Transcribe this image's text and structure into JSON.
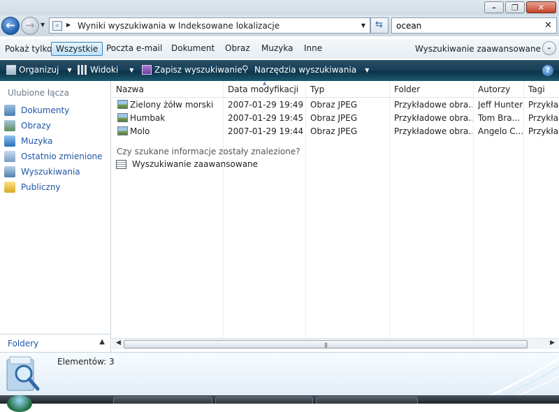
{
  "window": {
    "buttons": {
      "minimize": "minimize-icon",
      "maximize": "restore-icon",
      "close": "close-icon"
    }
  },
  "address": {
    "path": "Wyniki wyszukiwania w Indeksowane lokalizacje"
  },
  "search": {
    "value": "ocean"
  },
  "filter": {
    "label": "Pokaż tylko:",
    "options": [
      "Wszystkie",
      "Poczta e-mail",
      "Dokument",
      "Obraz",
      "Muzyka",
      "Inne"
    ],
    "active": "Wszystkie",
    "advanced": "Wyszukiwanie zaawansowane"
  },
  "toolbar": {
    "organize": "Organizuj",
    "views": "Widoki",
    "save_search": "Zapisz wyszukiwanie",
    "search_tools": "Narzędzia wyszukiwania"
  },
  "sidebar": {
    "heading": "Ulubione łącza",
    "items": [
      {
        "label": "Dokumenty",
        "icon": "documents-icon",
        "color": "#5b8bb8"
      },
      {
        "label": "Obrazy",
        "icon": "pictures-icon",
        "color": "#6b9c6a"
      },
      {
        "label": "Muzyka",
        "icon": "music-icon",
        "color": "#3b7fc4"
      },
      {
        "label": "Ostatnio zmienione",
        "icon": "recent-icon",
        "color": "#7a9cc4"
      },
      {
        "label": "Wyszukiwania",
        "icon": "searches-icon",
        "color": "#5a86b0"
      },
      {
        "label": "Publiczny",
        "icon": "public-folder-icon",
        "color": "#e8c24a"
      }
    ],
    "folders": "Foldery"
  },
  "table": {
    "columns": [
      "Nazwa",
      "Data modyfikacji",
      "Typ",
      "Folder",
      "Autorzy",
      "Tagi"
    ],
    "rows": [
      {
        "name": "Zielony żółw morski",
        "date": "2007-01-29 19:49",
        "type": "Obraz JPEG",
        "folder": "Przykładowe obra...",
        "authors": "Jeff Hunter",
        "tags": "Przykład"
      },
      {
        "name": "Humbak",
        "date": "2007-01-29 19:45",
        "type": "Obraz JPEG",
        "folder": "Przykładowe obra...",
        "authors": "Tom Bra...",
        "tags": "Przykład"
      },
      {
        "name": "Molo",
        "date": "2007-01-29 19:44",
        "type": "Obraz JPEG",
        "folder": "Przykładowe obra...",
        "authors": "Angelo C...",
        "tags": "Przykład"
      }
    ]
  },
  "found_question": "Czy szukane informacje zostały znalezione?",
  "advanced_link": "Wyszukiwanie zaawansowane",
  "details": {
    "count": "Elementów: 3"
  }
}
